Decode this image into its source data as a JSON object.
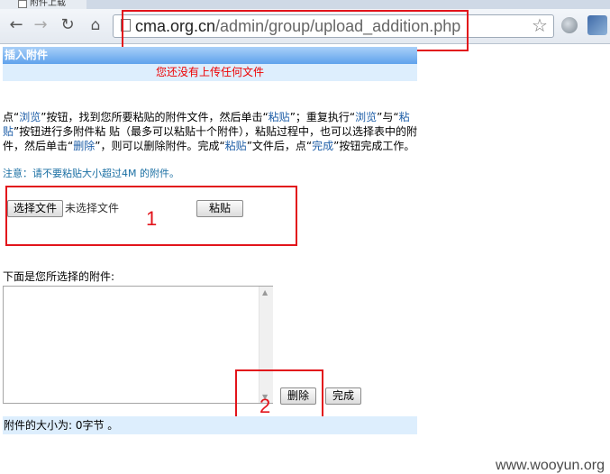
{
  "browser": {
    "tab_title": "附件上载",
    "url_domain": "cma.org.cn",
    "url_path": "/admin/group/upload_addition.php"
  },
  "page": {
    "header": "插入附件",
    "notice": "您还没有上传任何文件",
    "instructions": {
      "t1": "点“",
      "browse": "浏览",
      "t2": "”按钮，找到您所要粘贴的附件文件，然后单击“",
      "paste": "粘贴",
      "t3": "”；重复执行“",
      "browse2": "浏览",
      "t4": "”与“",
      "paste2": "粘贴",
      "t5": "”按钮进行多附件粘 贴（最多可以粘贴十个附件），粘贴过程中，也可以选择表中的附件，然后单击“",
      "delete": "删除",
      "t6": "”，则可以删除附件。完成“",
      "paste3": "粘贴",
      "t7": "”文件后，点“",
      "done": "完成",
      "t8": "”按钮完成工作。"
    },
    "warning": "注意：请不要粘贴大小超过4M 的附件。",
    "choose_file_button": "选择文件",
    "no_file_text": "未选择文件",
    "paste_button": "粘贴",
    "selected_label": "下面是您所选择的附件:",
    "delete_button": "删除",
    "done_button": "完成",
    "size_text": "附件的大小为: 0字节 。"
  },
  "annotations": {
    "label_1": "1",
    "label_2": "2",
    "color": "#e2141b"
  },
  "watermark": "www.wooyun.org"
}
